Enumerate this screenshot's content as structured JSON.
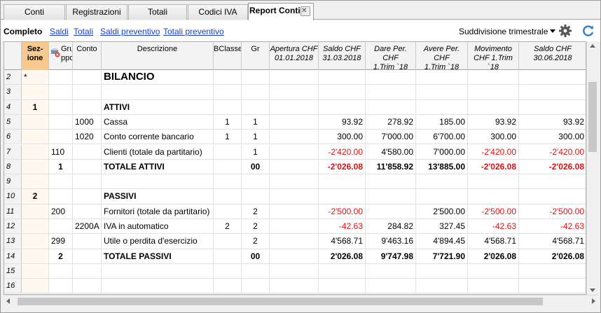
{
  "tabs": [
    {
      "label": "Conti",
      "active": false
    },
    {
      "label": "Registrazioni",
      "active": false
    },
    {
      "label": "Totali",
      "active": false
    },
    {
      "label": "Codici IVA",
      "active": false
    },
    {
      "label": "Report Conti",
      "active": true
    }
  ],
  "toolbar": {
    "view_label": "Completo",
    "links": [
      "Saldi",
      "Totali",
      "Saldi preventivo",
      "Totali preventivo"
    ],
    "subdivision": "Suddivisione trimestrale",
    "settings_icon": "gear-icon",
    "refresh_icon": "refresh-icon"
  },
  "columns": [
    {
      "label": "Sez-\nione"
    },
    {
      "label": "Gru\nppo"
    },
    {
      "label": "Conto"
    },
    {
      "label": "Descrizione"
    },
    {
      "label": "BClasse"
    },
    {
      "label": "Gr"
    },
    {
      "label": "Apertura CHF\n01.01.2018"
    },
    {
      "label": "Saldo CHF\n31.03.2018"
    },
    {
      "label": "Dare Per. CHF\n1.Trim `18"
    },
    {
      "label": "Avere Per. CHF\n1.Trim `18"
    },
    {
      "label": "Movimento\nCHF 1.Trim `18"
    },
    {
      "label": "Saldo CHF\n30.06.2018"
    }
  ],
  "rows": [
    {
      "n": "2",
      "sez": "*",
      "grp": "",
      "conto": "",
      "desc": "BILANCIO",
      "bcl": "",
      "gr": "",
      "ap": "",
      "saldo": "",
      "dare": "",
      "avere": "",
      "mov": "",
      "saldo2": "",
      "style": "title"
    },
    {
      "n": "3",
      "sez": "",
      "grp": "",
      "conto": "",
      "desc": "",
      "bcl": "",
      "gr": "",
      "ap": "",
      "saldo": "",
      "dare": "",
      "avere": "",
      "mov": "",
      "saldo2": "",
      "style": ""
    },
    {
      "n": "4",
      "sez": "1",
      "grp": "",
      "conto": "",
      "desc": "ATTIVI",
      "bcl": "",
      "gr": "",
      "ap": "",
      "saldo": "",
      "dare": "",
      "avere": "",
      "mov": "",
      "saldo2": "",
      "style": "bold"
    },
    {
      "n": "5",
      "sez": "",
      "grp": "",
      "conto": "1000",
      "desc": "Cassa",
      "bcl": "1",
      "gr": "1",
      "ap": "",
      "saldo": "93.92",
      "dare": "278.92",
      "avere": "185.00",
      "mov": "93.92",
      "saldo2": "93.92",
      "style": ""
    },
    {
      "n": "6",
      "sez": "",
      "grp": "",
      "conto": "1020",
      "desc": "Conto corrente bancario",
      "bcl": "1",
      "gr": "1",
      "ap": "",
      "saldo": "300.00",
      "dare": "7'000.00",
      "avere": "6'700.00",
      "mov": "300.00",
      "saldo2": "300.00",
      "style": ""
    },
    {
      "n": "7",
      "sez": "",
      "grp": "110",
      "conto": "",
      "desc": "Clienti (totale da partitario)",
      "bcl": "",
      "gr": "1",
      "ap": "",
      "saldo": "-2'420.00",
      "dare": "4'580.00",
      "avere": "7'000.00",
      "mov": "-2'420.00",
      "saldo2": "-2'420.00",
      "style": ""
    },
    {
      "n": "8",
      "sez": "",
      "grp": "1",
      "conto": "",
      "desc": "TOTALE ATTIVI",
      "bcl": "",
      "gr": "00",
      "ap": "",
      "saldo": "-2'026.08",
      "dare": "11'858.92",
      "avere": "13'885.00",
      "mov": "-2'026.08",
      "saldo2": "-2'026.08",
      "style": "bold"
    },
    {
      "n": "9",
      "sez": "",
      "grp": "",
      "conto": "",
      "desc": "",
      "bcl": "",
      "gr": "",
      "ap": "",
      "saldo": "",
      "dare": "",
      "avere": "",
      "mov": "",
      "saldo2": "",
      "style": ""
    },
    {
      "n": "10",
      "sez": "2",
      "grp": "",
      "conto": "",
      "desc": "PASSIVI",
      "bcl": "",
      "gr": "",
      "ap": "",
      "saldo": "",
      "dare": "",
      "avere": "",
      "mov": "",
      "saldo2": "",
      "style": "bold"
    },
    {
      "n": "11",
      "sez": "",
      "grp": "200",
      "conto": "",
      "desc": "Fornitori (totale da partitario)",
      "bcl": "",
      "gr": "2",
      "ap": "",
      "saldo": "-2'500.00",
      "dare": "",
      "avere": "2'500.00",
      "mov": "-2'500.00",
      "saldo2": "-2'500.00",
      "style": ""
    },
    {
      "n": "12",
      "sez": "",
      "grp": "",
      "conto": "2200A",
      "desc": "IVA in automatico",
      "bcl": "2",
      "gr": "2",
      "ap": "",
      "saldo": "-42.63",
      "dare": "284.82",
      "avere": "327.45",
      "mov": "-42.63",
      "saldo2": "-42.63",
      "style": ""
    },
    {
      "n": "13",
      "sez": "",
      "grp": "299",
      "conto": "",
      "desc": "Utile o perdita d'esercizio",
      "bcl": "",
      "gr": "2",
      "ap": "",
      "saldo": "4'568.71",
      "dare": "9'463.16",
      "avere": "4'894.45",
      "mov": "4'568.71",
      "saldo2": "4'568.71",
      "style": ""
    },
    {
      "n": "14",
      "sez": "",
      "grp": "2",
      "conto": "",
      "desc": "TOTALE PASSIVI",
      "bcl": "",
      "gr": "00",
      "ap": "",
      "saldo": "2'026.08",
      "dare": "9'747.98",
      "avere": "7'721.90",
      "mov": "2'026.08",
      "saldo2": "2'026.08",
      "style": "bold"
    },
    {
      "n": "15",
      "sez": "",
      "grp": "",
      "conto": "",
      "desc": "",
      "bcl": "",
      "gr": "",
      "ap": "",
      "saldo": "",
      "dare": "",
      "avere": "",
      "mov": "",
      "saldo2": "",
      "style": ""
    },
    {
      "n": "16",
      "sez": "",
      "grp": "",
      "conto": "",
      "desc": "",
      "bcl": "",
      "gr": "",
      "ap": "",
      "saldo": "",
      "dare": "",
      "avere": "",
      "mov": "",
      "saldo2": "",
      "style": ""
    }
  ],
  "colors": {
    "negative": "#e01010",
    "section_header": "#f7c98f",
    "link": "#1a3fc7"
  }
}
